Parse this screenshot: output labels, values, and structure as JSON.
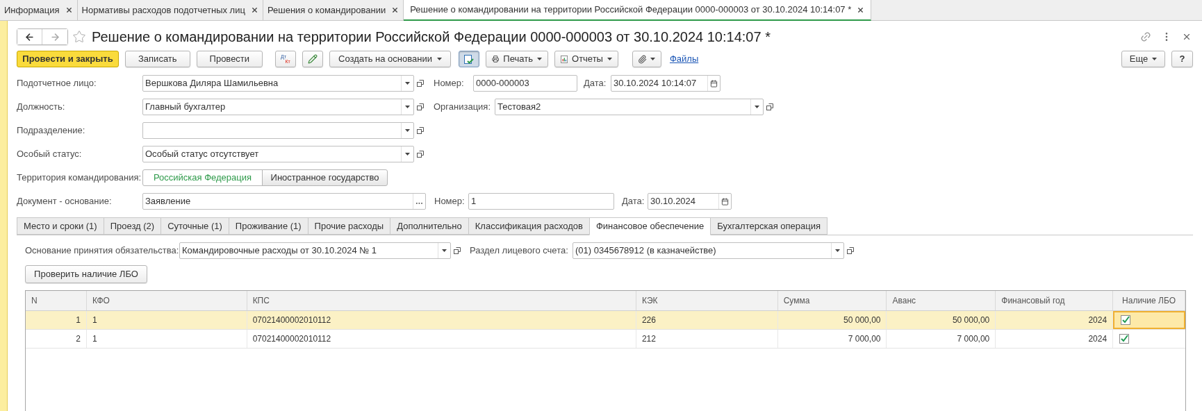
{
  "open_tabs": [
    {
      "label": "Информация",
      "selected": false
    },
    {
      "label": "Нормативы расходов подотчетных лиц",
      "selected": false
    },
    {
      "label": "Решения о командировании",
      "selected": false
    },
    {
      "label": "Решение о командировании на территории Российской Федерации 0000-000003 от 30.10.2024 10:14:07 *",
      "selected": true
    }
  ],
  "window": {
    "title": "Решение о командировании на территории Российской Федерации 0000-000003 от 30.10.2024 10:14:07 *"
  },
  "toolbar": [
    {
      "kind": "primary",
      "label": "Провести и закрыть"
    },
    {
      "kind": "button",
      "label": "Записать"
    },
    {
      "kind": "button",
      "label": "Провести"
    },
    {
      "kind": "dtkt",
      "label": "Дт",
      "sublabel": "Кт"
    },
    {
      "kind": "pencil"
    },
    {
      "kind": "menu",
      "label": "Создать на основании"
    },
    {
      "kind": "toggle",
      "on": true
    },
    {
      "kind": "print",
      "label": "Печать"
    },
    {
      "kind": "report",
      "label": "Отчеты"
    },
    {
      "kind": "clip"
    },
    {
      "kind": "link",
      "label": "Файлы"
    }
  ],
  "more_button": "Еще",
  "help_button": "?",
  "accountable_person": {
    "label": "Подотчетное лицо:",
    "value": "Вершкова Диляра Шамильевна"
  },
  "number": {
    "label": "Номер:",
    "value": "0000-000003"
  },
  "date": {
    "label": "Дата:",
    "value": "30.10.2024 10:14:07"
  },
  "position": {
    "label": "Должность:",
    "value": "Главный бухгалтер"
  },
  "organization": {
    "label": "Организация:",
    "value": "Тестовая2"
  },
  "department": {
    "label": "Подразделение:"
  },
  "special_status": {
    "label": "Особый статус:",
    "value": "Особый статус отсутствует"
  },
  "territory": {
    "label": "Территория командирования:",
    "options": [
      {
        "label": "Российская Федерация",
        "selected": true
      },
      {
        "label": "Иностранное государство",
        "selected": false
      }
    ]
  },
  "basis_document": {
    "label": "Документ - основание:",
    "value": "Заявление"
  },
  "basis_number": {
    "label": "Номер:",
    "value": "1"
  },
  "basis_date": {
    "label": "Дата:",
    "value": "30.10.2024"
  },
  "section_tabs": [
    {
      "label": "Место и сроки (1)",
      "selected": false
    },
    {
      "label": "Проезд (2)",
      "selected": false
    },
    {
      "label": "Суточные (1)",
      "selected": false
    },
    {
      "label": "Проживание (1)",
      "selected": false
    },
    {
      "label": "Прочие расходы",
      "selected": false
    },
    {
      "label": "Дополнительно",
      "selected": false
    },
    {
      "label": "Классификация расходов",
      "selected": false
    },
    {
      "label": "Финансовое обеспечение",
      "selected": true
    },
    {
      "label": "Бухгалтерская операция",
      "selected": false
    }
  ],
  "financing": {
    "obligation_basis": {
      "label": "Основание принятия обязательства:",
      "value": "Командировочные расходы от 30.10.2024 № 1"
    },
    "account_section": {
      "label": "Раздел лицевого счета:",
      "value": "(01) 0345678912 (в казначействе)"
    },
    "check_button": "Проверить наличие ЛБО",
    "table": {
      "columns": [
        "N",
        "КФО",
        "КПС",
        "КЭК",
        "Сумма",
        "Аванс",
        "Финансовый год",
        "Наличие ЛБО"
      ],
      "rows": [
        {
          "n": "1",
          "kfo": "1",
          "kps": "07021400002010112",
          "kek": "226",
          "sum": "50 000,00",
          "advance": "50 000,00",
          "year": "2024",
          "lbo": true,
          "selected": true
        },
        {
          "n": "2",
          "kfo": "1",
          "kps": "07021400002010112",
          "kek": "212",
          "sum": "7 000,00",
          "advance": "7 000,00",
          "year": "2024",
          "lbo": true,
          "selected": false
        }
      ]
    }
  }
}
